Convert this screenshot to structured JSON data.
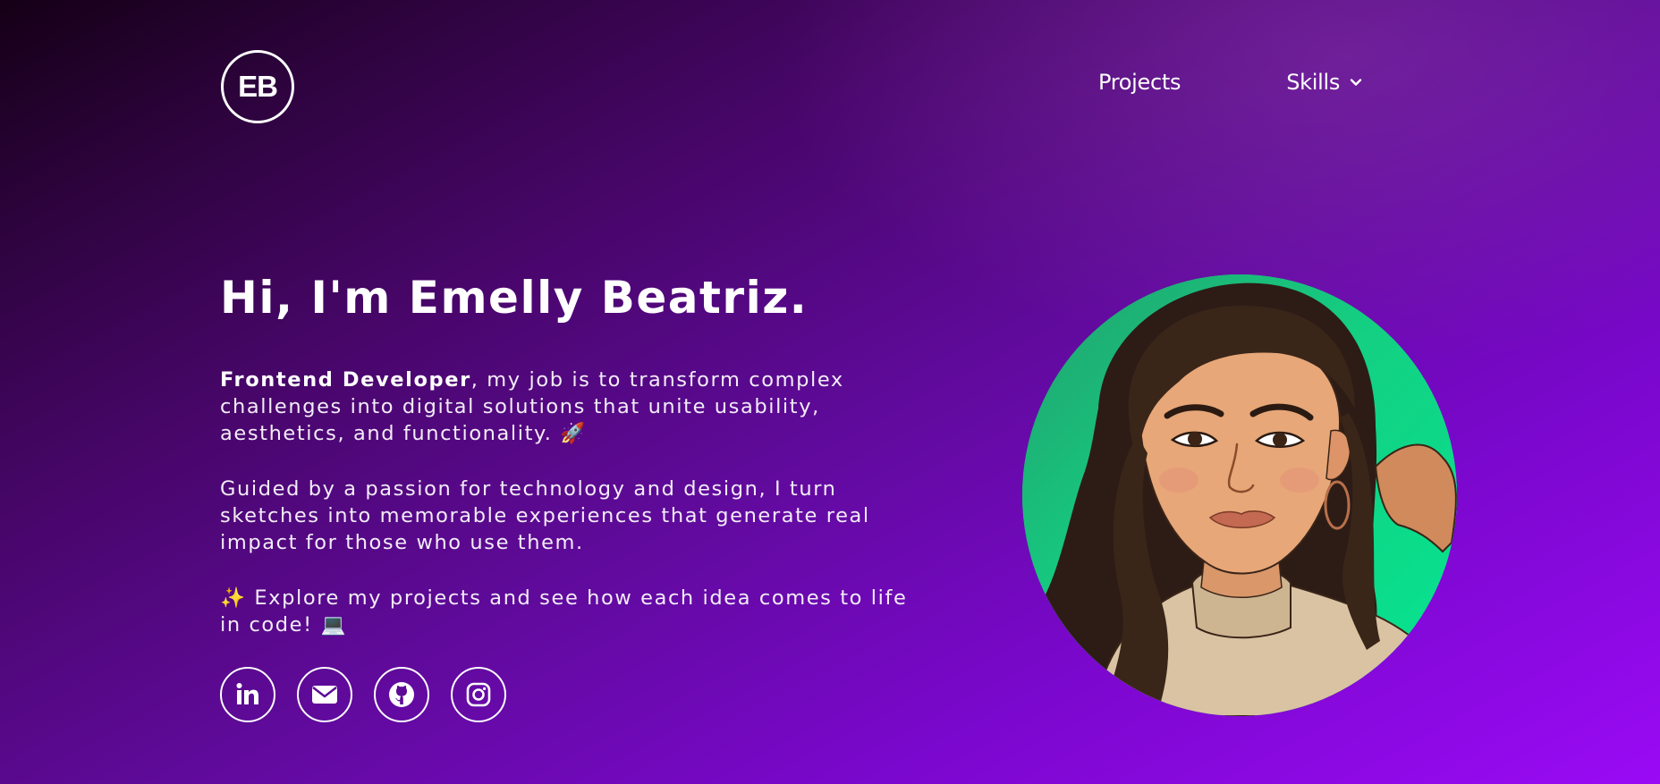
{
  "header": {
    "logo": "EB",
    "nav": {
      "projects": "Projects",
      "skills": "Skills"
    }
  },
  "hero": {
    "title": "Hi, I'm Emelly Beatriz.",
    "p1_strong": "Frontend Developer",
    "p1_rest": ", my job is to transform complex challenges into digital solutions that unite usability, aesthetics, and functionality. 🚀",
    "p2": "Guided by a passion for technology and design, I turn sketches into memorable experiences that generate real impact for those who use them.",
    "p3": "✨ Explore my projects and see how each idea comes to life in code! 💻"
  },
  "social": [
    {
      "name": "linkedin",
      "icon": "linkedin-icon"
    },
    {
      "name": "email",
      "icon": "mail-icon"
    },
    {
      "name": "github",
      "icon": "github-icon"
    },
    {
      "name": "instagram",
      "icon": "instagram-icon"
    }
  ],
  "colors": {
    "background_start": "#150016",
    "background_mid": "#5f0a9a",
    "background_end": "#9a0af5",
    "avatar_bg": "#0be48f",
    "text": "#ffffff"
  }
}
